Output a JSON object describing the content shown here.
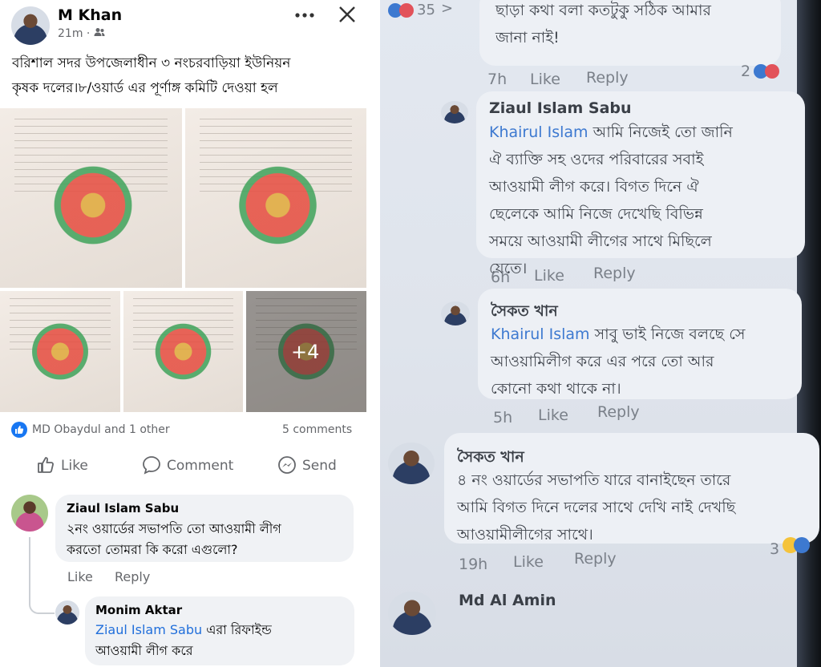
{
  "post": {
    "author": "M Khan",
    "time": "21m",
    "privacy_sep": "·",
    "text_line1": "বরিশাল সদর উপজেলাধীন ৩ নংচরবাড়িয়া ইউনিয়ন",
    "text_line2": "কৃষক দলের।৮/ওয়ার্ড এর পূর্ণাঙ্গ কমিটি দেওয়া হল",
    "more_photos": "+4",
    "reactions_text": "MD Obaydul and 1 other",
    "comments_count": "5 comments",
    "actions": {
      "like": "Like",
      "comment": "Comment",
      "send": "Send"
    }
  },
  "comments": [
    {
      "name": "Ziaul Islam Sabu",
      "line1": "২নং ওয়ার্ডের সভাপতি তো আওয়ামী লীগ",
      "line2": "করতো তোমরা কি করো এগুলো?",
      "like": "Like",
      "reply": "Reply"
    },
    {
      "name": "Monim Aktar",
      "mention": "Ziaul Islam Sabu",
      "line1_rest": " এরা রিফাইন্ড",
      "line2": "আওয়ামী লীগ করে"
    }
  ],
  "right": {
    "top_count": "35",
    "top_arrow": ">",
    "c0": {
      "line0": "ছাড়া কথা বলা কতটুকু সঠিক আমার",
      "line1": "জানা নাই!",
      "time": "7h",
      "like": "Like",
      "reply": "Reply",
      "react_count": "2"
    },
    "c1": {
      "name": "Ziaul Islam Sabu",
      "mention": "Khairul Islam",
      "line1_rest": " আমি নিজেই তো জানি",
      "line2": "ঐ ব্যাক্তি সহ ওদের পরিবারের সবাই",
      "line3": "আওয়ামী লীগ করে। বিগত দিনে ঐ",
      "line4": "ছেলেকে আমি নিজে দেখেছি বিভিন্ন",
      "line5": "সময়ে আওয়ামী লীগের সাথে মিছিলে",
      "line6": "যেতে।",
      "time": "6h",
      "like": "Like",
      "reply": "Reply"
    },
    "c2": {
      "name": "সৈকত খান",
      "mention": "Khairul Islam",
      "line1_rest": " সাবু ভাই নিজে বলছে সে",
      "line2": "আওয়ামিলীগ করে এর পরে তো আর",
      "line3": "কোনো কথা থাকে না।",
      "time": "5h",
      "like": "Like",
      "reply": "Reply"
    },
    "c3": {
      "name": "সৈকত খান",
      "line1": "৪ নং ওয়ার্ডের সভাপতি যারে বানাইছেন তারে",
      "line2": "আমি বিগত দিনে দলের সাথে দেখি নাই দেখছি",
      "line3": "আওয়ামীলীগের সাথে।",
      "time": "19h",
      "like": "Like",
      "reply": "Reply",
      "react_count": "3"
    },
    "c4": {
      "name": "Md Al Amin"
    }
  }
}
